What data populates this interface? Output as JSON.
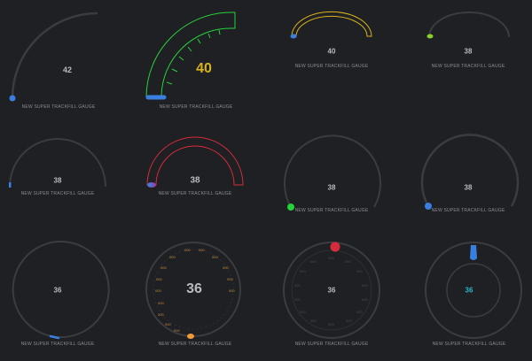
{
  "gauges": [
    {
      "value": "42",
      "caption": "NEW SUPER TRACKFILL GAUGE"
    },
    {
      "value": "40",
      "caption": "NEW SUPER TRACKFILL GAUGE"
    },
    {
      "value": "40",
      "caption": "NEW SUPER TRACKFILL GAUGE"
    },
    {
      "value": "38",
      "caption": "NEW SUPER TRACKFILL GAUGE"
    },
    {
      "value": "38",
      "caption": "NEW SUPER TRACKFILL GAUGE"
    },
    {
      "value": "38",
      "caption": "NEW SUPER TRACKFILL GAUGE"
    },
    {
      "value": "38",
      "caption": "NEW SUPER TRACKFILL GAUGE"
    },
    {
      "value": "38",
      "caption": "NEW SUPER TRACKFILL GAUGE"
    },
    {
      "value": "36",
      "caption": "NEW SUPER TRACKFILL GAUGE"
    },
    {
      "value": "36",
      "caption": "NEW SUPER TRACKFILL GAUGE"
    },
    {
      "value": "36",
      "caption": "NEW SUPER TRACKFILL GAUGE"
    },
    {
      "value": "36",
      "caption": "NEW SUPER TRACKFILL GAUGE"
    }
  ],
  "colors": {
    "background": "#1f2024",
    "track": "#3a3c40",
    "blue": "#3a7fe0",
    "green": "#27d13a",
    "yellow": "#d8b21c",
    "lime": "#8ccf2a",
    "red": "#d42c3a",
    "orange": "#f29a3a",
    "cyan": "#25b8c8"
  }
}
